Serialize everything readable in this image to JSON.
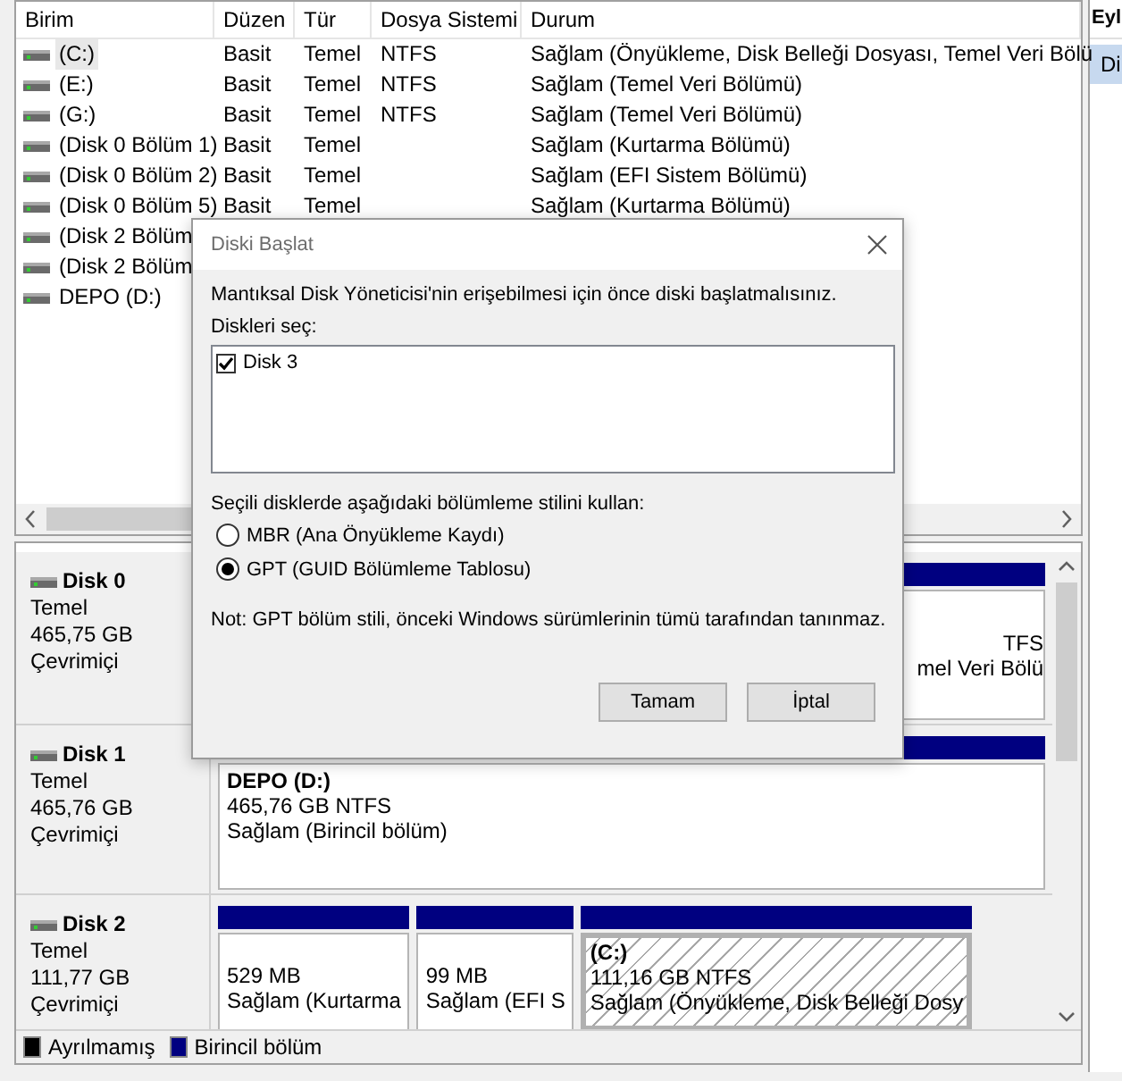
{
  "volumes": {
    "columns": [
      "Birim",
      "Düzen",
      "Tür",
      "Dosya Sistemi",
      "Durum"
    ],
    "rows": [
      {
        "selected": true,
        "cells": [
          "(C:)",
          "Basit",
          "Temel",
          "NTFS",
          "Sağlam (Önyükleme, Disk Belleği Dosyası, Temel Veri Bölü"
        ]
      },
      {
        "selected": false,
        "cells": [
          "(E:)",
          "Basit",
          "Temel",
          "NTFS",
          "Sağlam (Temel Veri Bölümü)"
        ]
      },
      {
        "selected": false,
        "cells": [
          "(G:)",
          "Basit",
          "Temel",
          "NTFS",
          "Sağlam (Temel Veri Bölümü)"
        ]
      },
      {
        "selected": false,
        "cells": [
          "(Disk 0 Bölüm 1)",
          "Basit",
          "Temel",
          "",
          "Sağlam (Kurtarma Bölümü)"
        ]
      },
      {
        "selected": false,
        "cells": [
          "(Disk 0 Bölüm 2)",
          "Basit",
          "Temel",
          "",
          "Sağlam (EFI Sistem Bölümü)"
        ]
      },
      {
        "selected": false,
        "cells": [
          "(Disk 0 Bölüm 5)",
          "Basit",
          "Temel",
          "",
          "Sağlam (Kurtarma Bölümü)"
        ]
      },
      {
        "selected": false,
        "cells": [
          "(Disk 2 Bölüm",
          "",
          "",
          "",
          ""
        ]
      },
      {
        "selected": false,
        "cells": [
          "(Disk 2 Bölüm",
          "",
          "",
          "",
          ""
        ]
      },
      {
        "selected": false,
        "cells": [
          "DEPO (D:)",
          "",
          "",
          "",
          ""
        ]
      }
    ]
  },
  "disks": [
    {
      "name": "Disk 0",
      "type": "Temel",
      "size": "465,75 GB",
      "status": "Çevrimiçi",
      "partitions": [
        {
          "size": "TFS",
          "status": "mel Veri Bölü",
          "selected": false,
          "hatched": false
        }
      ]
    },
    {
      "name": "Disk 1",
      "type": "Temel",
      "size": "465,76 GB",
      "status": "Çevrimiçi",
      "partitions": [
        {
          "label": "DEPO  (D:)",
          "size": "465,76 GB NTFS",
          "status": "Sağlam (Birincil bölüm)",
          "selected": false,
          "hatched": false
        }
      ]
    },
    {
      "name": "Disk 2",
      "type": "Temel",
      "size": "111,77 GB",
      "status": "Çevrimiçi",
      "partitions": [
        {
          "size": "529 MB",
          "status": "Sağlam (Kurtarma",
          "selected": false,
          "hatched": false
        },
        {
          "size": "99 MB",
          "status": "Sağlam (EFI S",
          "selected": false,
          "hatched": false
        },
        {
          "label": "(C:)",
          "size": "111,16 GB NTFS",
          "status": "Sağlam (Önyükleme, Disk Belleği Dosy",
          "selected": true,
          "hatched": true
        }
      ]
    }
  ],
  "legend": [
    {
      "label": "Ayrılmamış",
      "color": "#000000"
    },
    {
      "label": "Birincil bölüm",
      "color": "#000080"
    }
  ],
  "side_panel": {
    "title": "Eyl",
    "items": [
      {
        "label": "Di",
        "selected": true
      }
    ]
  },
  "dialog": {
    "title": "Diski Başlat",
    "message": "Mantıksal Disk Yöneticisi'nin erişebilmesi için önce diski başlatmalısınız.",
    "list_label": "Diskleri seç:",
    "disks": [
      {
        "label": "Disk 3",
        "checked": true
      }
    ],
    "style_label": "Seçili disklerde aşağıdaki bölümleme stilini kullan:",
    "options": [
      {
        "label": "MBR (Ana Önyükleme Kaydı)",
        "selected": false
      },
      {
        "label": "GPT (GUID Bölümleme Tablosu)",
        "selected": true
      }
    ],
    "note": "Not: GPT bölüm stili, önceki Windows sürümlerinin tümü tarafından tanınmaz.",
    "buttons": [
      "Tamam",
      "İptal"
    ]
  }
}
